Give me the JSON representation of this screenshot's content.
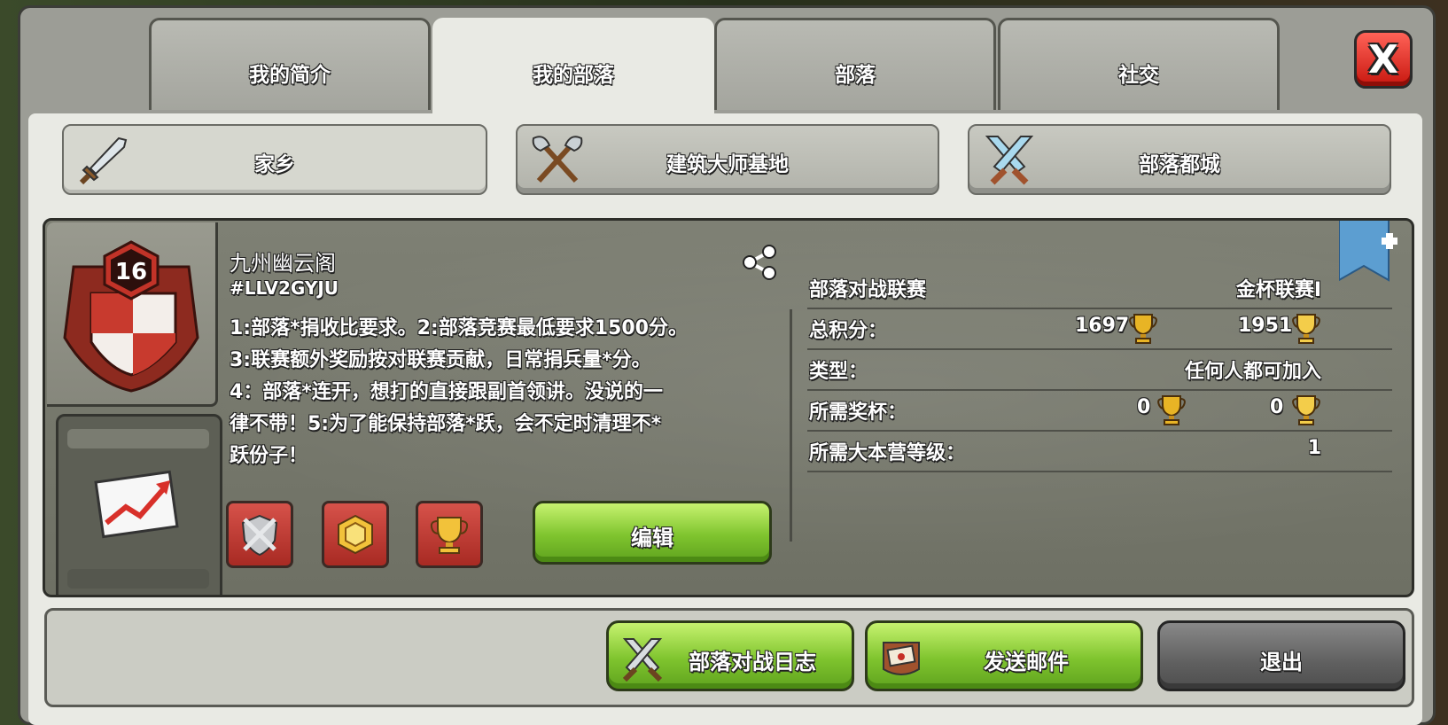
{
  "tabs": [
    {
      "label": "我的简介",
      "active": false
    },
    {
      "label": "我的部落",
      "active": true
    },
    {
      "label": "部落",
      "active": false
    },
    {
      "label": "社交",
      "active": false
    }
  ],
  "close_button": {
    "glyph": "X"
  },
  "subtabs": [
    {
      "label": "家乡",
      "icon": "sword-icon",
      "active": true
    },
    {
      "label": "建筑大师基地",
      "icon": "crossed-axes-icon",
      "active": false
    },
    {
      "label": "部落都城",
      "icon": "crossed-swords-icon",
      "active": false
    }
  ],
  "clan": {
    "level": "16",
    "name": "九州幽云阁",
    "tag": "#LLV2GYJU",
    "description": [
      "1:部落*捐收比要求。2:部落竞赛最低要求1500分。",
      "3:联赛额外奖励按对联赛贡献，日常捐兵量*分。",
      "4：部落*连开，想打的直接跟副首领讲。没说的一",
      "律不带！5:为了能保持部落*跃，会不定时清理不*",
      "跃份子！"
    ],
    "edit_label": "编辑"
  },
  "info": {
    "league_label": "部落对战联赛",
    "league_value": "金杯联赛I",
    "points_label": "总积分：",
    "points_home": "1697",
    "points_builder": "1951",
    "type_label": "类型：",
    "type_value": "任何人都可加入",
    "required_trophies_label": "所需奖杯：",
    "required_trophies_home": "0",
    "required_trophies_builder": "0",
    "required_th_label": "所需大本营等级：",
    "required_th_value": "1"
  },
  "bottom": {
    "war_log_label": "部落对战日志",
    "send_mail_label": "发送邮件",
    "leave_label": "退出"
  },
  "colors": {
    "accent_green": "#7fc42e",
    "close_red": "#c8170f",
    "badge_red": "#b8342a",
    "trophy_gold": "#e8b425"
  }
}
